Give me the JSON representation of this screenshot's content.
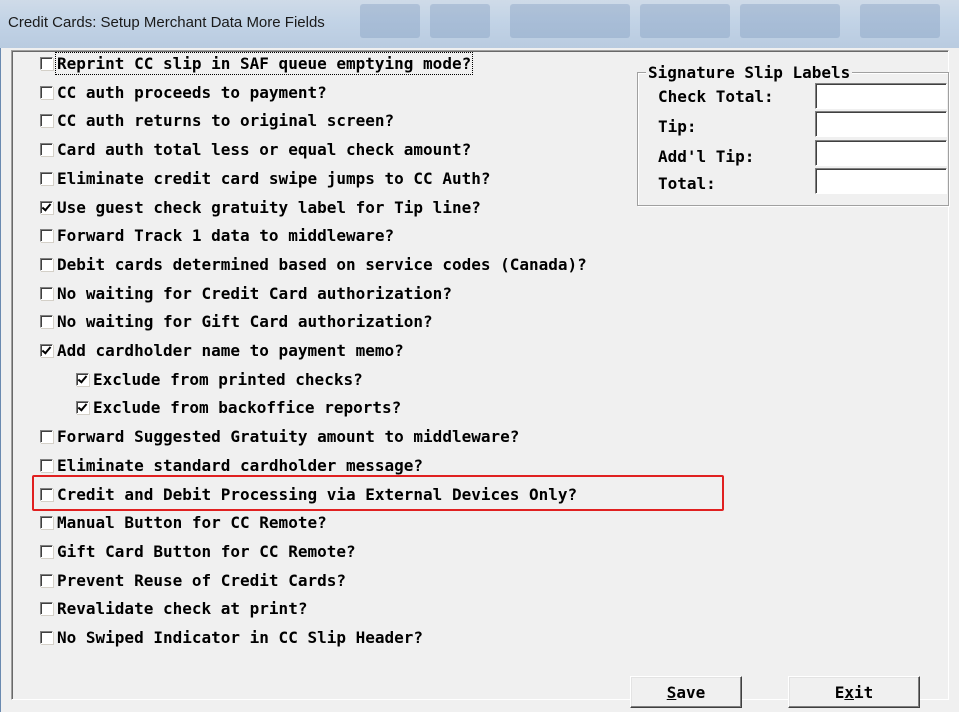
{
  "window": {
    "title": "Credit Cards: Setup Merchant Data More Fields"
  },
  "options": [
    {
      "label": "Reprint CC slip in SAF queue emptying mode?",
      "checked": false,
      "indent": 0,
      "focused": true
    },
    {
      "label": "CC auth proceeds to payment?",
      "checked": false,
      "indent": 0
    },
    {
      "label": "CC auth returns to original screen?",
      "checked": false,
      "indent": 0
    },
    {
      "label": "Card auth total less or equal check amount?",
      "checked": false,
      "indent": 0
    },
    {
      "label": "Eliminate credit card swipe jumps to CC Auth?",
      "checked": false,
      "indent": 0
    },
    {
      "label": "Use guest check gratuity label for Tip line?",
      "checked": true,
      "indent": 0
    },
    {
      "label": "Forward Track 1 data to middleware?",
      "checked": false,
      "indent": 0
    },
    {
      "label": "Debit cards determined based on service codes (Canada)?",
      "checked": false,
      "indent": 0
    },
    {
      "label": "No waiting for Credit Card authorization?",
      "checked": false,
      "indent": 0
    },
    {
      "label": "No waiting for Gift Card authorization?",
      "checked": false,
      "indent": 0
    },
    {
      "label": "Add cardholder name to payment memo?",
      "checked": true,
      "indent": 0
    },
    {
      "label": "Exclude from printed checks?",
      "checked": true,
      "indent": 1
    },
    {
      "label": "Exclude from backoffice reports?",
      "checked": true,
      "indent": 1
    },
    {
      "label": "Forward Suggested Gratuity amount to middleware?",
      "checked": false,
      "indent": 0
    },
    {
      "label": "Eliminate standard cardholder message?",
      "checked": false,
      "indent": 0
    },
    {
      "label": "Credit and Debit Processing via External Devices Only?",
      "checked": false,
      "indent": 0,
      "highlighted": true
    },
    {
      "label": "Manual Button for CC Remote?",
      "checked": false,
      "indent": 0
    },
    {
      "label": "Gift Card Button for CC Remote?",
      "checked": false,
      "indent": 0
    },
    {
      "label": "Prevent Reuse of Credit Cards?",
      "checked": false,
      "indent": 0
    },
    {
      "label": "Revalidate check at print?",
      "checked": false,
      "indent": 0
    },
    {
      "label": "No Swiped Indicator in CC Slip Header?",
      "checked": false,
      "indent": 0
    }
  ],
  "signature_slip": {
    "title": "Signature Slip Labels",
    "fields": [
      {
        "label": "Check Total:",
        "value": ""
      },
      {
        "label": "Tip:",
        "value": ""
      },
      {
        "label": "Add'l Tip:",
        "value": ""
      },
      {
        "label": "Total:",
        "value": ""
      }
    ]
  },
  "buttons": {
    "save": {
      "hotkey": "S",
      "rest": "ave"
    },
    "exit": {
      "pre": "E",
      "hotkey": "x",
      "rest": "it"
    }
  },
  "colors": {
    "highlight": "#e02020",
    "window_bg": "#f0f0f0"
  }
}
